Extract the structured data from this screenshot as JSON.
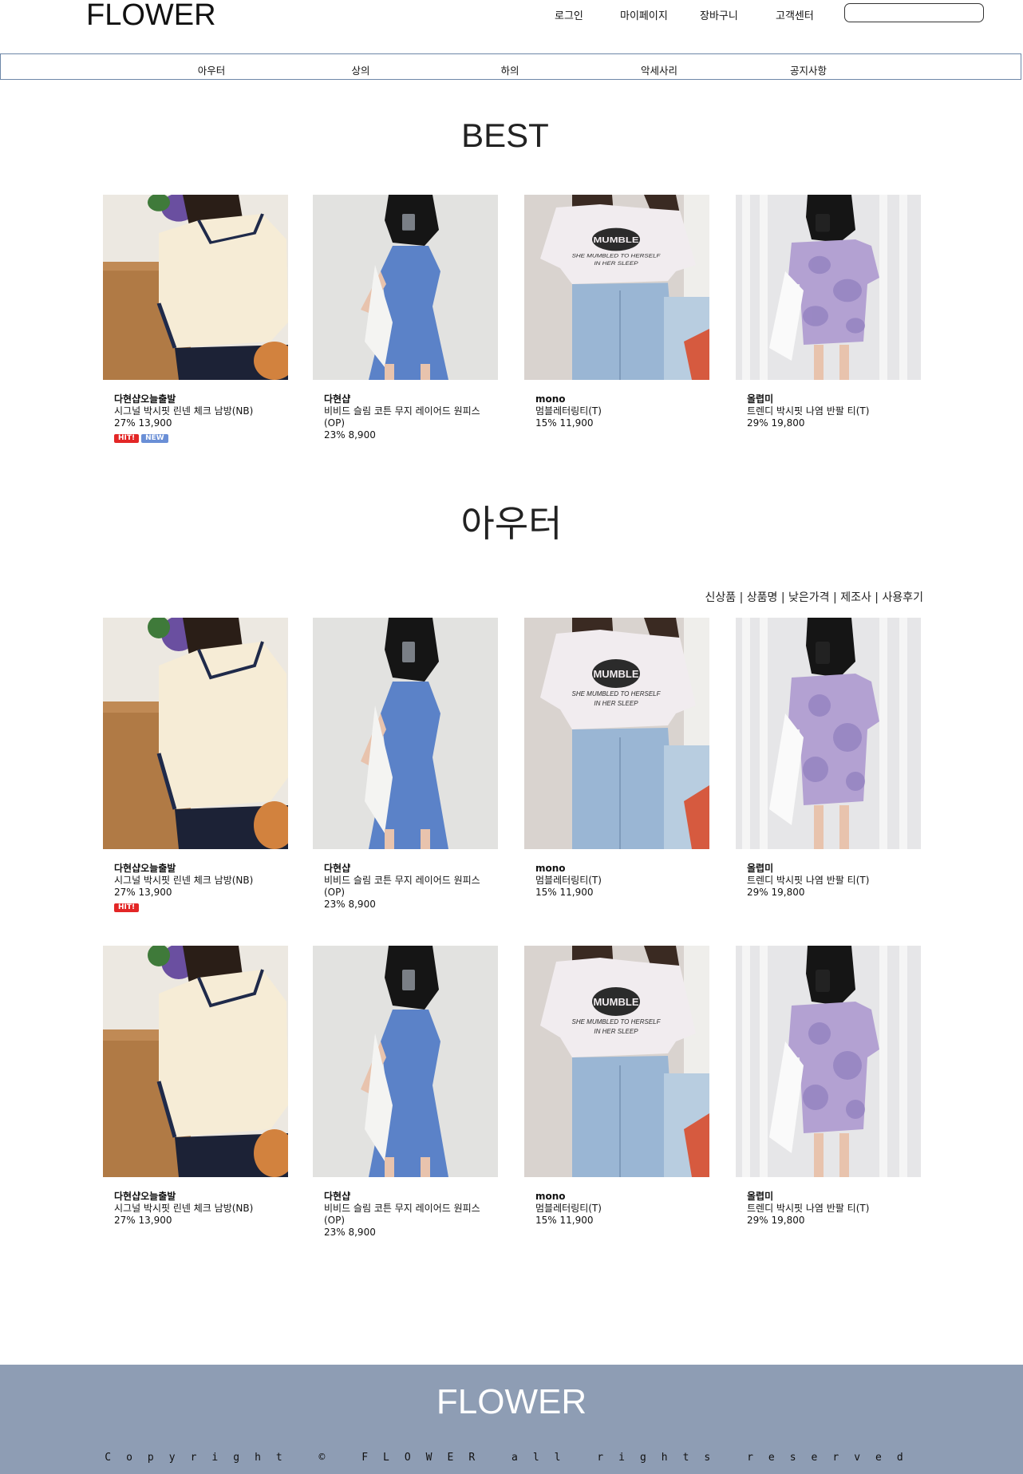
{
  "header": {
    "logo": "FLOWER",
    "nav": [
      "로그인",
      "마이페이지",
      "장바구니",
      "고객센터"
    ],
    "search_placeholder": ""
  },
  "categories": [
    "아우터",
    "상의",
    "하의",
    "악세사리",
    "공지사항"
  ],
  "best": {
    "title": "BEST",
    "products": [
      {
        "brand": "다현샵오늘출발",
        "name": "시그널 박시핏 린넨 체크 남방(NB)",
        "price": "27% 13,900",
        "badges": [
          "HIT!",
          "NEW"
        ]
      },
      {
        "brand": "다현샵",
        "name": "비비드 슬림 코튼 무지 레이어드 원피스(OP)",
        "price": "23% 8,900",
        "badges": []
      },
      {
        "brand": "mono",
        "name": "멈블레터링티(T)",
        "price": "15% 11,900",
        "badges": []
      },
      {
        "brand": "올렵미",
        "name": "트렌디 박시핏 나염 반팔 티(T)",
        "price": "29% 19,800",
        "badges": []
      }
    ]
  },
  "outer": {
    "title": "아우터",
    "sort": [
      "신상품",
      "상품명",
      "낮은가격",
      "제조사",
      "사용후기"
    ],
    "rows": [
      [
        {
          "brand": "다현샵오늘출발",
          "name": "시그널 박시핏 린넨 체크 남방(NB)",
          "price": "27% 13,900",
          "badges": [
            "HIT!"
          ]
        },
        {
          "brand": "다현샵",
          "name": "비비드 슬림 코튼 무지 레이어드 원피스(OP)",
          "price": "23% 8,900",
          "badges": []
        },
        {
          "brand": "mono",
          "name": "멈블레터링티(T)",
          "price": "15% 11,900",
          "badges": []
        },
        {
          "brand": "올렵미",
          "name": "트렌디 박시핏 나염 반팔 티(T)",
          "price": "29% 19,800",
          "badges": []
        }
      ],
      [
        {
          "brand": "다현샵오늘출발",
          "name": "시그널 박시핏 린넨 체크 남방(NB)",
          "price": "27% 13,900",
          "badges": []
        },
        {
          "brand": "다현샵",
          "name": "비비드 슬림 코튼 무지 레이어드 원피스(OP)",
          "price": "23% 8,900",
          "badges": []
        },
        {
          "brand": "mono",
          "name": "멈블레터링티(T)",
          "price": "15% 11,900",
          "badges": []
        },
        {
          "brand": "올렵미",
          "name": "트렌디 박시핏 나염 반팔 티(T)",
          "price": "29% 19,800",
          "badges": []
        }
      ]
    ]
  },
  "tshirt_print": "MUMBLE",
  "footer": {
    "logo": "FLOWER",
    "copyright": "Copyright © FLOWER all rights reserved"
  },
  "colors": {
    "footer_bg": "#8e9db4",
    "nav_border": "#6d87a8",
    "hit_badge": "#e32626",
    "new_badge": "#6a8fd6"
  }
}
